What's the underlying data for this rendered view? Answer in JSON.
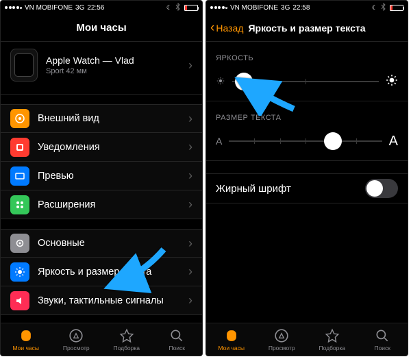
{
  "status": {
    "carrier": "VN MOBIFONE",
    "network": "3G",
    "time_left": "22:56",
    "time_right": "22:58",
    "battery_pct": 14
  },
  "left": {
    "title": "Мои часы",
    "watch": {
      "name": "Apple Watch — Vlad",
      "sub": "Sport 42 мм"
    },
    "group1": [
      {
        "icon": "appearance",
        "color": "#ff9500",
        "label": "Внешний вид"
      },
      {
        "icon": "notifications",
        "color": "#ff3b30",
        "label": "Уведомления"
      },
      {
        "icon": "glances",
        "color": "#007aff",
        "label": "Превью"
      },
      {
        "icon": "extensions",
        "color": "#34c759",
        "label": "Расширения"
      }
    ],
    "group2": [
      {
        "icon": "general",
        "color": "#8e8e93",
        "label": "Основные"
      },
      {
        "icon": "brightness",
        "color": "#007aff",
        "label": "Яркость и размер текста"
      },
      {
        "icon": "sounds",
        "color": "#ff3b30",
        "label": "Звуки, тактильные сигналы"
      }
    ]
  },
  "right": {
    "back": "Назад",
    "title": "Яркость и размер текста",
    "brightness_label": "ЯРКОСТЬ",
    "textsize_label": "РАЗМЕР ТЕКСТА",
    "brightness_value": 8,
    "textsize_value": 68,
    "bold_label": "Жирный шрифт",
    "bold_on": false,
    "a_small": "A",
    "a_big": "A"
  },
  "tabs": [
    {
      "id": "mywatch",
      "label": "Мои часы"
    },
    {
      "id": "browse",
      "label": "Просмотр"
    },
    {
      "id": "featured",
      "label": "Подборка"
    },
    {
      "id": "search",
      "label": "Поиск"
    }
  ]
}
